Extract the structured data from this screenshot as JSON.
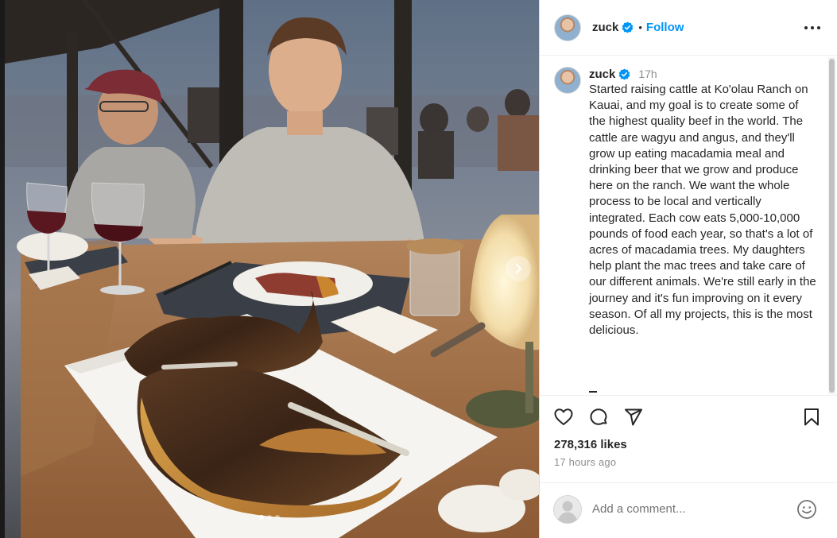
{
  "post": {
    "username": "zuck",
    "follow_label": "Follow",
    "separator": "•",
    "time": "17h",
    "caption": "Started raising cattle at Ko'olau Ranch on Kauai, and my goal is to create some of the highest quality beef in the world. The cattle are wagyu and angus, and they'll grow up eating macadamia meal and drinking beer that we grow and produce here on the ranch. We want the whole process to be local and vertically integrated. Each cow eats 5,000-10,000 pounds of food each year, so that's a lot of acres of macadamia trees. My daughters help plant the mac trees and take care of our different animals. We're still early in the journey and it's fun improving on it every season. Of all my projects, this is the most delicious.",
    "likes": "278,316 likes",
    "posted_ago": "17 hours ago"
  },
  "comment": {
    "placeholder": "Add a comment..."
  },
  "carousel": {
    "count": 3,
    "active_index": 0
  },
  "icons": {
    "verified": "verified-badge-icon",
    "more": "more-options-icon",
    "like": "heart-icon",
    "comment": "comment-bubble-icon",
    "share": "paper-plane-icon",
    "save": "bookmark-icon",
    "emoji": "emoji-smiley-icon",
    "next": "chevron-right-icon"
  },
  "colors": {
    "accent": "#0095f6",
    "verified": "#0095f6",
    "secondary_text": "#8e8e8e"
  }
}
